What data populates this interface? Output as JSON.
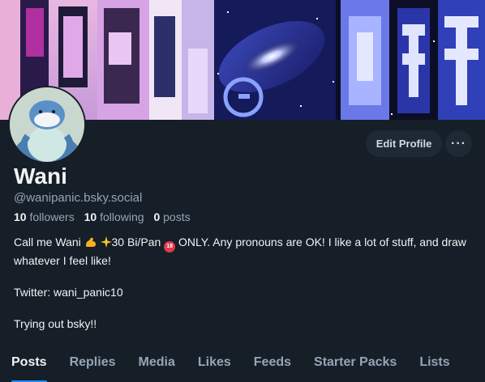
{
  "profile": {
    "display_name": "Wani",
    "handle": "@wanipanic.bsky.social",
    "stats": {
      "followers_count": "10",
      "followers_label": "followers",
      "following_count": "10",
      "following_label": "following",
      "posts_count": "0",
      "posts_label": "posts"
    },
    "bio": {
      "line1_a": "Call me Wani",
      "line1_b": "30 Bi/Pan",
      "line1_c": "ONLY. Any pronouns are OK! I like a lot of stuff, and draw whatever I feel like!",
      "emoji_18_text": "18",
      "twitter": "Twitter: wani_panic10",
      "trying": "Trying out bsky!!"
    }
  },
  "actions": {
    "edit_profile": "Edit Profile",
    "more": "···"
  },
  "tabs": [
    "Posts",
    "Replies",
    "Media",
    "Likes",
    "Feeds",
    "Starter Packs",
    "Lists"
  ],
  "colors": {
    "background": "#161e27",
    "accent": "#208bfe",
    "muted_text": "#93a5b7",
    "button_bg": "#1e2936"
  }
}
